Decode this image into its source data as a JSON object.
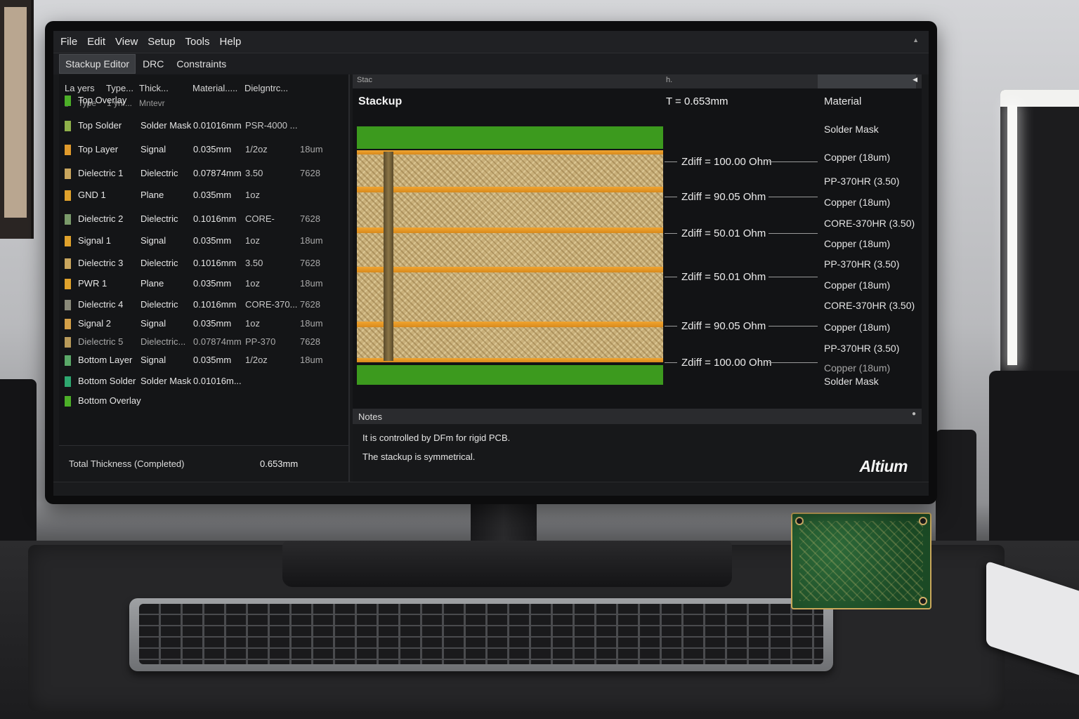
{
  "menu": [
    "File",
    "Edit",
    "View",
    "Setup",
    "Tools",
    "Help"
  ],
  "tabs": [
    "Stackup Editor",
    "DRC",
    "Constraints"
  ],
  "layers_table": {
    "headers": [
      "La yers",
      "Type...",
      "Thick...",
      "Material.....",
      "Dielgntrc..."
    ],
    "subheaders": [
      "Type",
      "1 ynr...",
      "Mntevr",
      "",
      ""
    ],
    "rows": [
      {
        "name": "Top Overlay",
        "type": "",
        "thickness": "",
        "material": "",
        "extra": "",
        "color": "#4caf28"
      },
      {
        "name": "Top Solder",
        "type": "Solder Mask",
        "thickness": "0.01016mm",
        "material": "PSR-4000 ...",
        "extra": "",
        "color": "#8fb04a"
      },
      {
        "name": "Top Layer",
        "type": "Signal",
        "thickness": "0.035mm",
        "material": "1/2oz",
        "extra": "18um",
        "color": "#e09a2c"
      },
      {
        "name": "Dielectric 1",
        "type": "Dielectric",
        "thickness": "0.07874mm",
        "material": "3.50",
        "extra": "7628",
        "color": "#c9a65e"
      },
      {
        "name": "GND 1",
        "type": "Plane",
        "thickness": "0.035mm",
        "material": "1oz",
        "extra": "",
        "color": "#e0a22c"
      },
      {
        "name": "Dielectric 2",
        "type": "Dielectric",
        "thickness": "0.1016mm",
        "material": "CORE-",
        "extra": "7628",
        "color": "#7a9a6a"
      },
      {
        "name": "Signal 1",
        "type": "Signal",
        "thickness": "0.035mm",
        "material": "1oz",
        "extra": "18um",
        "color": "#e0a22c"
      },
      {
        "name": "Dielectric 3",
        "type": "Dielectric",
        "thickness": "0.1016mm",
        "material": "3.50",
        "extra": "7628",
        "color": "#c9a65e"
      },
      {
        "name": "PWR 1",
        "type": "Plane",
        "thickness": "0.035mm",
        "material": "1oz",
        "extra": "18um",
        "color": "#e0a22c"
      },
      {
        "name": "Dielectric 4",
        "type": "Dielectric",
        "thickness": "0.1016mm",
        "material": "CORE-370...",
        "extra": "7628",
        "color": "#8a8a7a"
      },
      {
        "name": "Signal 2",
        "type": "Signal",
        "thickness": "0.035mm",
        "material": "1oz",
        "extra": "18um",
        "color": "#d4a048"
      },
      {
        "name": "Dielectric 5",
        "type": "Dielectric...",
        "thickness": "0.07874mm",
        "material": "PP-370",
        "extra": "7628",
        "color": "#b89a5a"
      },
      {
        "name": "Bottom Layer",
        "type": "Signal",
        "thickness": "0.035mm",
        "material": "1/2oz",
        "extra": "18um",
        "color": "#5aa868"
      },
      {
        "name": "Bottom Solder",
        "type": "Solder Mask",
        "thickness": "0.01016m...",
        "material": "",
        "extra": "",
        "color": "#2ea870"
      },
      {
        "name": "Bottom Overlay",
        "type": "",
        "thickness": "",
        "material": "",
        "extra": "",
        "color": "#4caf28"
      }
    ],
    "total_label": "Total Thickness (Completed)",
    "total_value": "0.653mm"
  },
  "stackup": {
    "title": "Stackup",
    "topbar_left": "Stac",
    "topbar_mid": "h.",
    "thickness": "T = 0.653mm",
    "material_header": "Material",
    "impedances": [
      "Zdiff = 100.00 Ohm",
      "Zdiff = 90.05 Ohm",
      "Zdiff = 50.01 Ohm",
      "Zdiff = 50.01 Ohm",
      "Zdiff = 90.05 Ohm",
      "Zdiff = 100.00 Ohm"
    ],
    "materials": [
      "Solder Mask",
      "Copper (18um)",
      "PP-370HR (3.50)",
      "Copper (18um)",
      "CORE-370HR (3.50)",
      "Copper (18um)",
      "PP-370HR (3.50)",
      "Copper (18um)",
      "CORE-370HR (3.50)",
      "Copper (18um)",
      "PP-370HR (3.50)",
      "Copper (18um)",
      "Solder Mask"
    ]
  },
  "notes": {
    "title": "Notes",
    "lines": [
      "It is controlled by DFm for rigid PCB.",
      "The stackup is symmetrical."
    ]
  },
  "brand": "Altium",
  "colors": {
    "solder_mask": "#3c9a1e",
    "copper": "#e59a28",
    "dielectric": "#c9b07a",
    "ui_bg": "#18191b"
  }
}
